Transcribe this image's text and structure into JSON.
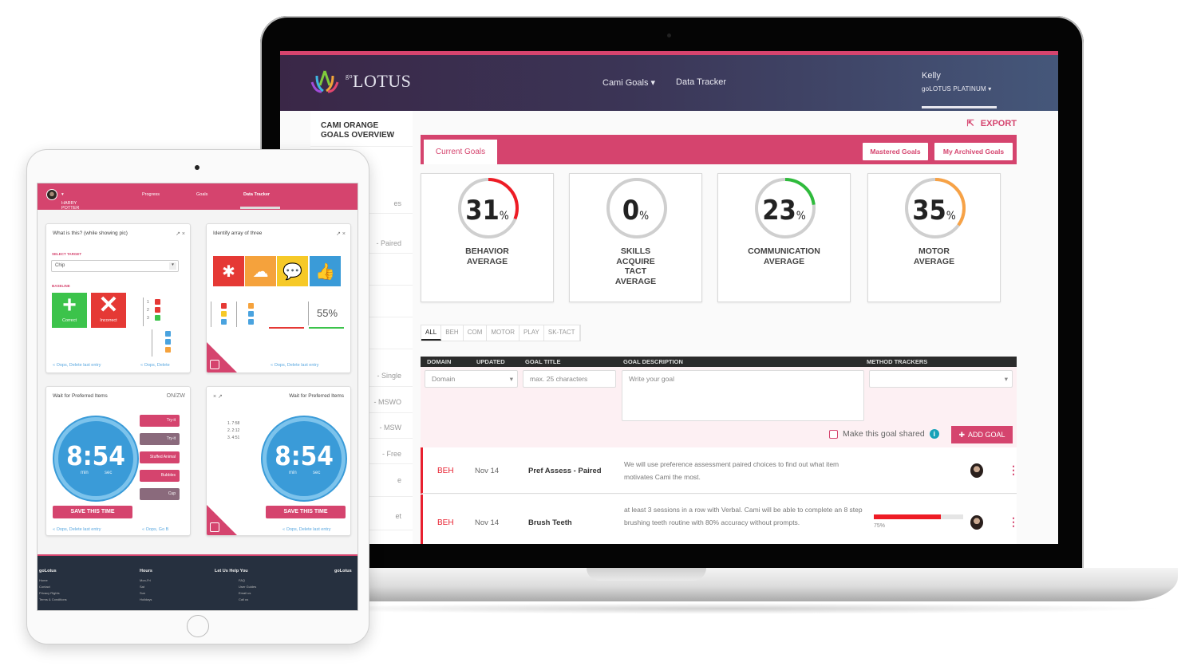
{
  "laptop": {
    "brand": {
      "logo_text": "LOTUS",
      "logo_prefix": "go"
    },
    "nav": {
      "items": [
        {
          "label": "Cami Goals",
          "has_dropdown": true
        },
        {
          "label": "Data Tracker",
          "has_dropdown": false
        }
      ],
      "user_name": "Kelly",
      "user_plan": "goLOTUS PLATINUM"
    },
    "sidebar": {
      "title_line1": "CAMI ORANGE",
      "title_line2": "GOALS OVERVIEW",
      "partial_items": [
        "es",
        "- Paired",
        "- Single",
        "- MSWO",
        "- MSW",
        "- Free",
        "e",
        "et"
      ]
    },
    "export_label": "EXPORT",
    "tabs": {
      "current": "Current Goals",
      "mastered": "Mastered Goals",
      "archived": "My Archived Goals"
    },
    "stats": [
      {
        "value": 31,
        "unit": "%",
        "label": "BEHAVIOR AVERAGE",
        "color": "#ee1c25"
      },
      {
        "value": 0,
        "unit": "%",
        "label": "SKILLS ACQUIRE TACT AVERAGE",
        "color": "#cccccc"
      },
      {
        "value": 23,
        "unit": "%",
        "label": "COMMUNICATION AVERAGE",
        "color": "#2fbb3c"
      },
      {
        "value": 35,
        "unit": "%",
        "label": "MOTOR AVERAGE",
        "color": "#f7a246"
      }
    ],
    "filters": [
      "ALL",
      "BEH",
      "COM",
      "MOTOR",
      "PLAY",
      "SK-TACT"
    ],
    "active_filter": "ALL",
    "table_headers": {
      "domain": "DOMAIN",
      "updated": "UPDATED",
      "goal_title": "GOAL TITLE",
      "goal_description": "GOAL DESCRIPTION",
      "method_trackers": "METHOD TRACKERS"
    },
    "add_form": {
      "domain_select": "Domain",
      "title_placeholder": "max. 25 characters",
      "description_placeholder": "Write your goal",
      "method_select": "",
      "shared_label": "Make this goal shared",
      "shared_checked": false,
      "add_button": "ADD GOAL"
    },
    "goals": [
      {
        "domain": "BEH",
        "updated": "Nov 14",
        "title": "Pref Assess - Paired",
        "description": "We will use preference assessment paired choices to find out what item motivates Cami the most.",
        "progress": null
      },
      {
        "domain": "BEH",
        "updated": "Nov 14",
        "title": "Brush Teeth",
        "description": "at least 3 sessions in a row with Verbal. Cami will be able to complete an 8 step brushing teeth routine with 80% accuracy without prompts.",
        "progress": 75,
        "progress_label": "75%"
      }
    ],
    "colors": {
      "accent": "#d5446e",
      "nav_start": "#3a2747",
      "nav_end": "#45577a",
      "behavior": "#ee1c25"
    }
  },
  "tablet": {
    "nav": {
      "user": "HARRY POTTER",
      "items": [
        "Progress",
        "Goals",
        "Data Tracker"
      ],
      "active": "Data Tracker"
    },
    "cards": [
      {
        "title": "What is this? (while showing pic)",
        "select_label": "SELECT TARGET",
        "select_value": "Chip",
        "baseline_label": "BASELINE",
        "correct_label": "Correct",
        "incorrect_label": "Incorrect",
        "trial_numbers": [
          "1",
          "2",
          "3"
        ],
        "footer_left": "« Oops, Delete last entry",
        "footer_right": "« Oops, Delete"
      },
      {
        "title": "Identify array of three",
        "percent": "55%",
        "footer_right": "« Oops, Delete last entry"
      },
      {
        "title": "Wait for Preferred Items",
        "status": "ON/ZW",
        "timer": "8:54",
        "min_label": "min",
        "sec_label": "sec",
        "save_button": "SAVE THIS TIME",
        "pills": [
          "Try-it",
          "Try-it",
          "Stuffed Animal",
          "Bubbles",
          "Cup"
        ],
        "footer_left": "« Oops, Delete last entry",
        "footer_right": "« Oops, Go B"
      },
      {
        "title": "Wait for Preferred Items",
        "timer": "8:54",
        "min_label": "min",
        "sec_label": "sec",
        "save_button": "SAVE THIS TIME",
        "footer_right": "« Oops, Delete last entry"
      }
    ],
    "footer": {
      "col1": "goLotus",
      "col1_items": [
        "Home",
        "Contact",
        "Privacy Rights",
        "Terms & Conditions"
      ],
      "col2": "Hours",
      "col2_items": [
        "Mon-Fri",
        "Sat",
        "Sun",
        "Holidays"
      ],
      "col3": "Let Us Help You",
      "col3_items": [
        "FAQ",
        "User Guides",
        "Email us",
        "Call us"
      ],
      "col4": "goLotus"
    }
  }
}
